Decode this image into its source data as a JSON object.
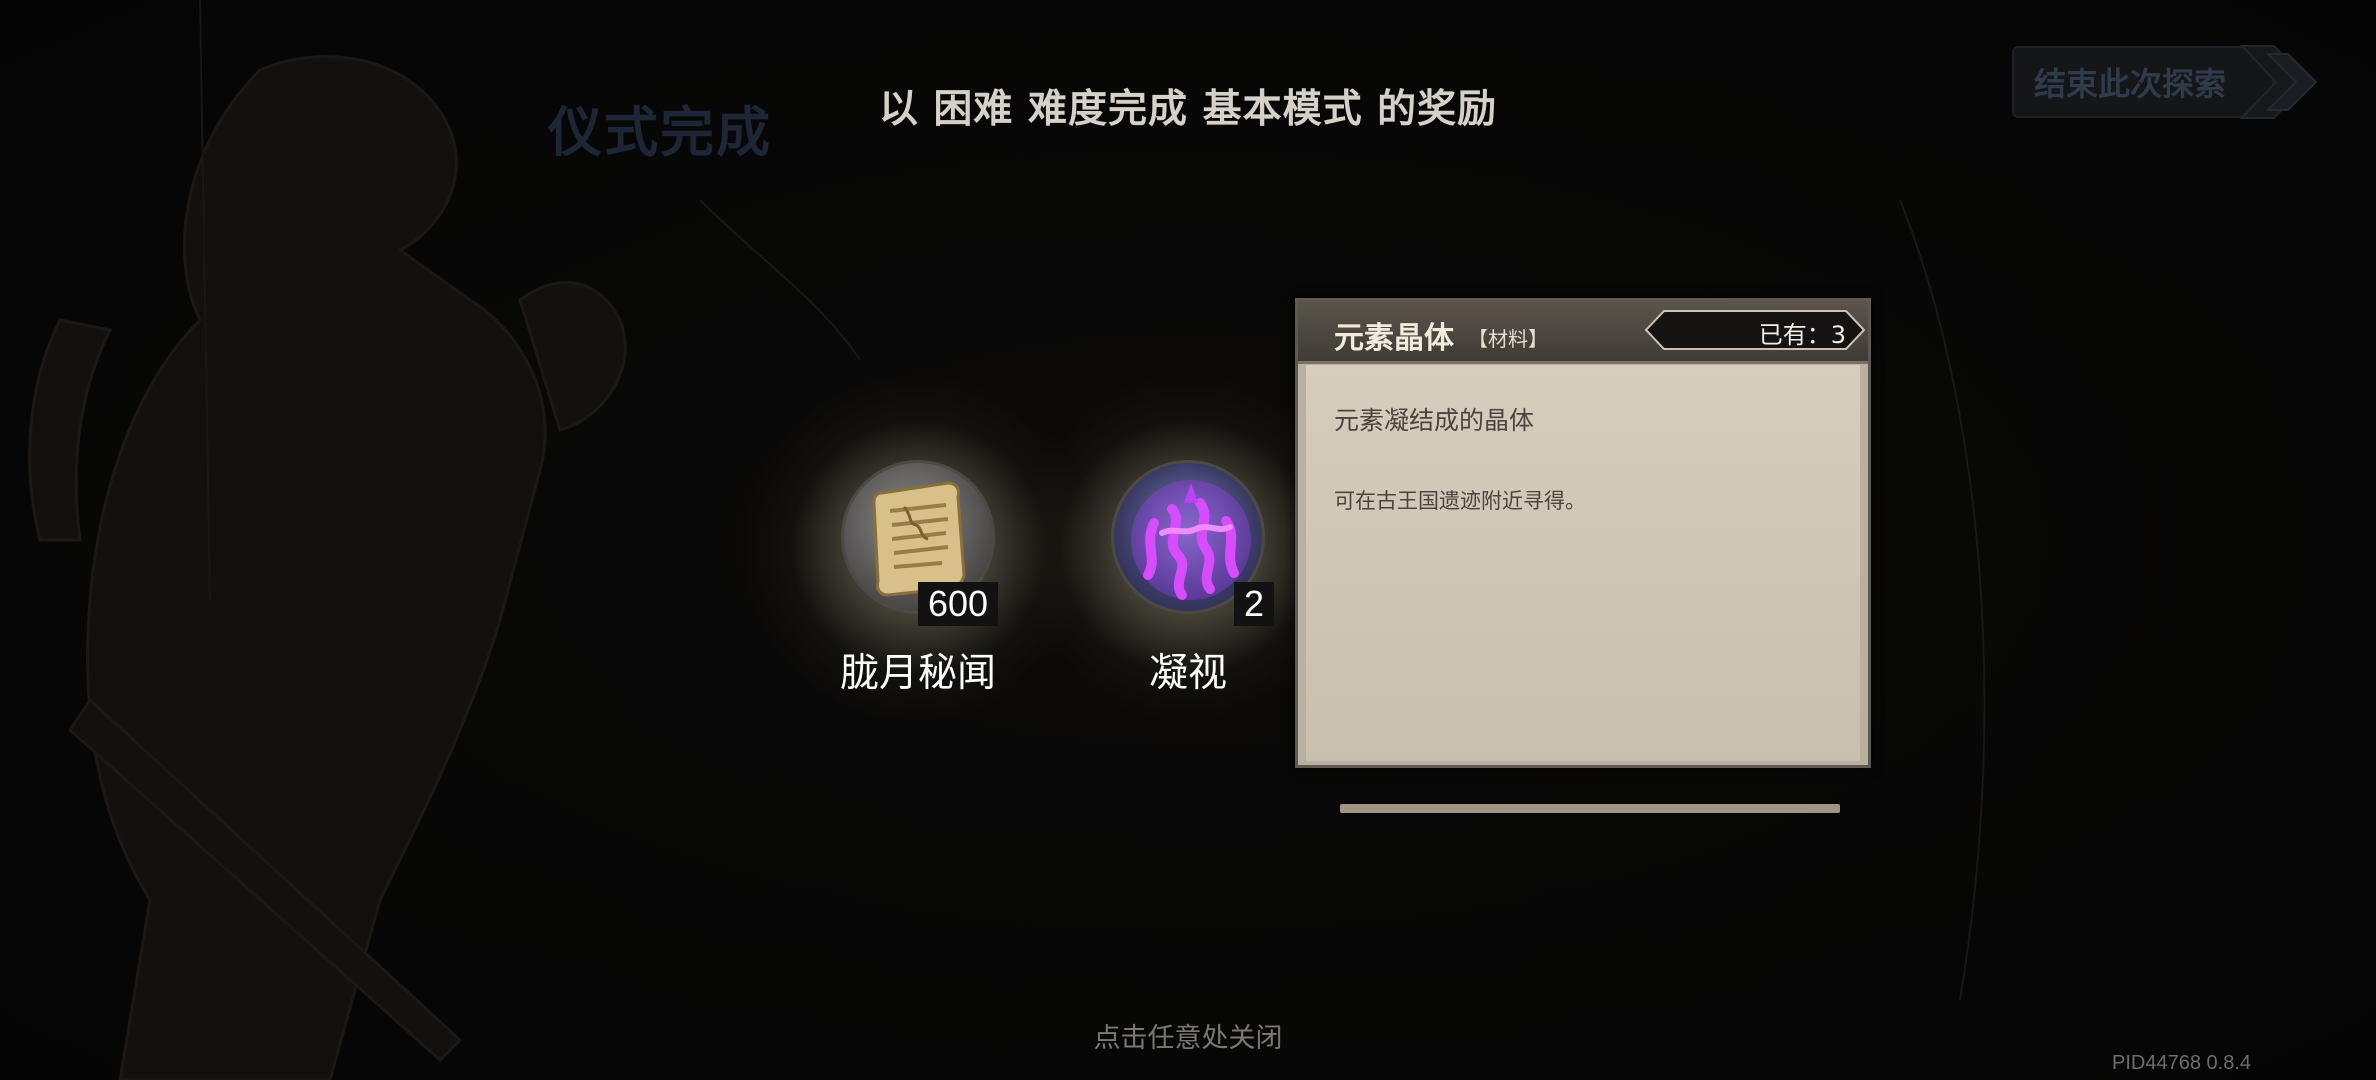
{
  "background": {
    "title": "仪式完成"
  },
  "header": {
    "headline": "以 困难 难度完成 基本模式 的奖励",
    "end_button_label": "结束此次探索"
  },
  "rewards": [
    {
      "name": "胧月秘闻",
      "quantity": "600",
      "icon": "scroll-icon"
    },
    {
      "name": "凝视",
      "quantity": "2",
      "icon": "purple-rune-icon"
    }
  ],
  "tooltip": {
    "title": "元素晶体",
    "tag": "【材料】",
    "owned": "已有：3",
    "description": "元素凝结成的晶体",
    "source": "可在古王国遗迹附近寻得。"
  },
  "footer": {
    "close_hint": "点击任意处关闭",
    "version": "PID44768  0.8.4"
  },
  "colors": {
    "background": "#080706",
    "tooltip_body": "#d6cdbd",
    "tooltip_header": "#4a453e",
    "purple_rune": "#c040ff",
    "scroll_tan": "#d8c088"
  }
}
